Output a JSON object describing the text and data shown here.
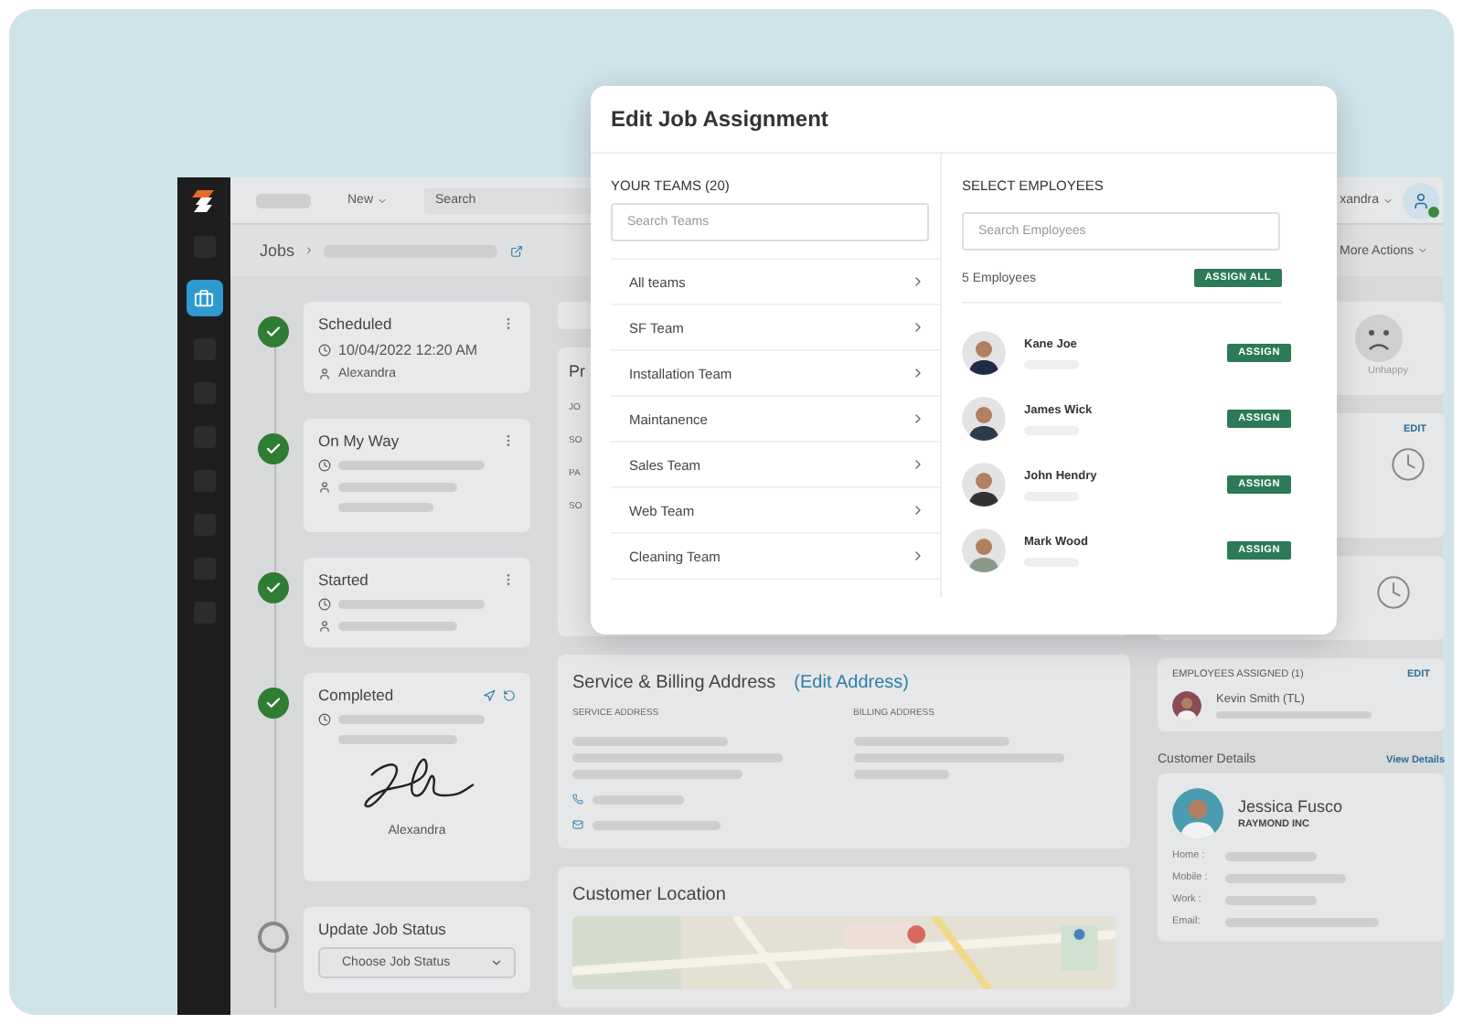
{
  "topbar": {
    "new_menu": "New",
    "search": "Search",
    "user": "xandra"
  },
  "breadcrumb": {
    "root": "Jobs"
  },
  "more_actions": "More Actions",
  "timeline": [
    {
      "kind": "info",
      "status": "Scheduled",
      "done": true,
      "date": "10/04/2022 12:20 AM",
      "person": "Alexandra"
    },
    {
      "kind": "blank",
      "status": "On My Way",
      "done": true
    },
    {
      "kind": "blank",
      "status": "Started",
      "done": true
    },
    {
      "kind": "signature",
      "status": "Completed",
      "done": true,
      "signer": "Alexandra"
    },
    {
      "kind": "select",
      "status": "Update Job Status",
      "done": false,
      "placeholder": "Choose Job Status"
    }
  ],
  "details_card": {
    "title": "Pr",
    "labels": [
      "JO",
      "SO",
      "PA",
      "SO"
    ]
  },
  "service_billing": {
    "title": "Service & Billing Address",
    "edit_link": "(Edit Address)",
    "service_label": "SERVICE ADDRESS",
    "billing_label": "BILLING ADDRESS"
  },
  "customer_location": {
    "title": "Customer Location"
  },
  "mood": {
    "label": "Unhappy"
  },
  "schedule_card": {
    "edit": "EDIT"
  },
  "employees_assigned": {
    "title": "EMPLOYEES ASSIGNED (1)",
    "edit": "EDIT",
    "name": "Kevin Smith  (TL)"
  },
  "customer_details": {
    "title": "Customer Details",
    "link": "View Details",
    "name": "Jessica Fusco",
    "company": "RAYMOND INC",
    "fields": [
      "Home :",
      "Mobile :",
      "Work :",
      "Email:"
    ]
  },
  "modal": {
    "title": "Edit Job Assignment",
    "teams_heading": "YOUR TEAMS (20)",
    "teams_placeholder": "Search Teams",
    "teams": [
      "All teams",
      "SF Team",
      "Installation Team",
      "Maintanence",
      "Sales Team",
      "Web Team",
      "Cleaning Team"
    ],
    "employees_heading": "SELECT EMPLOYEES",
    "employees_placeholder": "Search Employees",
    "count": "5 Employees",
    "assign_all": "ASSIGN ALL",
    "employees": [
      {
        "name": "Kane Joe",
        "action": "ASSIGN"
      },
      {
        "name": "James Wick",
        "action": "ASSIGN"
      },
      {
        "name": "John Hendry",
        "action": "ASSIGN"
      },
      {
        "name": "Mark Wood",
        "action": "ASSIGN"
      }
    ]
  }
}
